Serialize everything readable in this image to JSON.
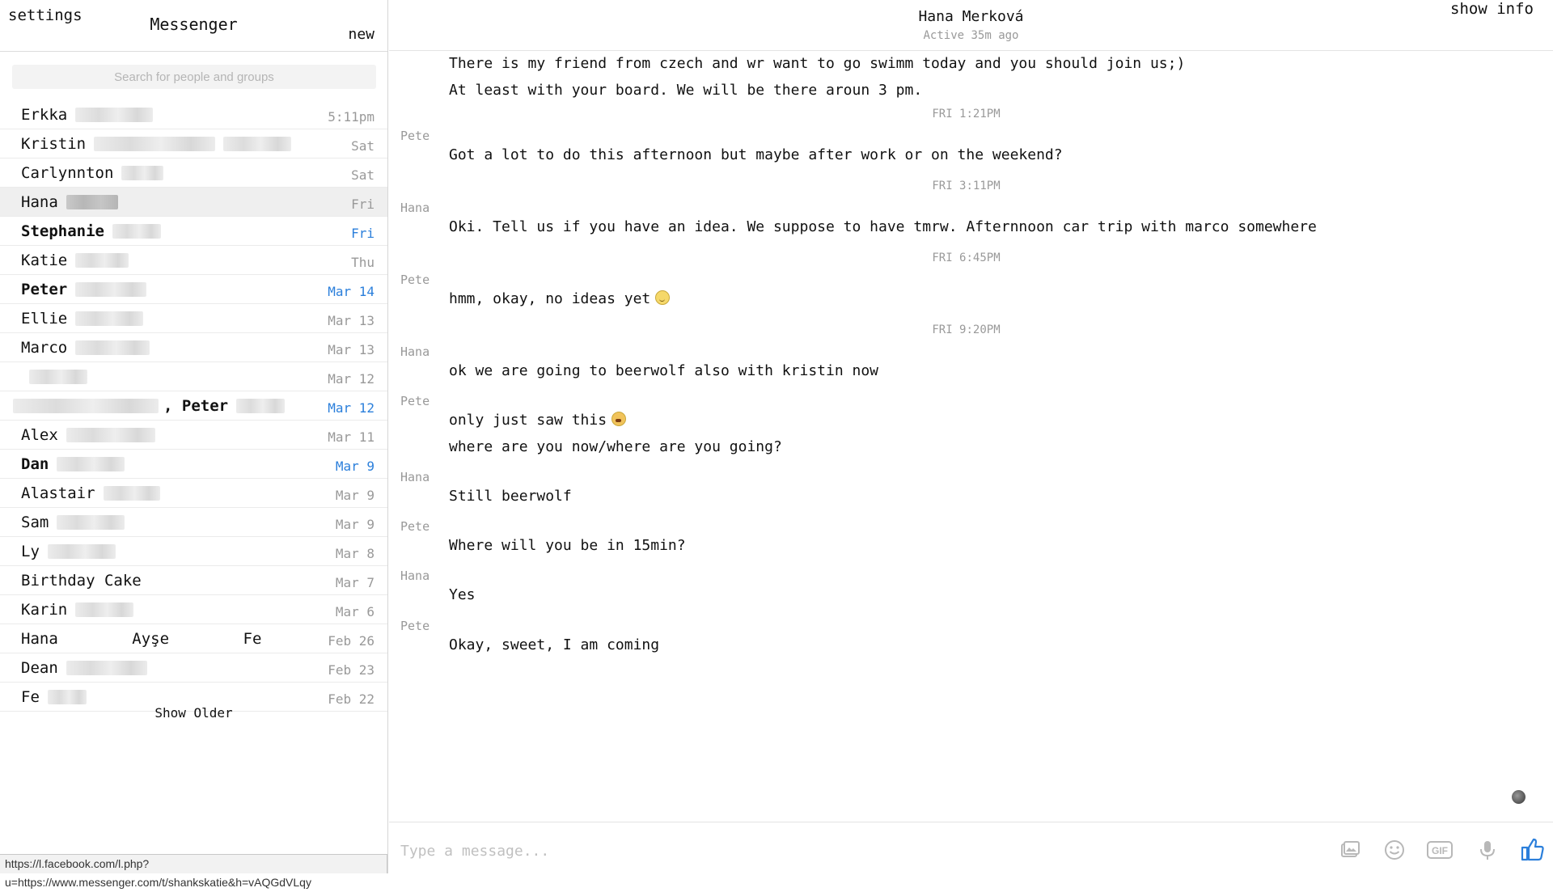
{
  "sidebar": {
    "settings_label": "settings",
    "title": "Messenger",
    "new_label": "new",
    "search_placeholder": "Search for people and groups",
    "show_older_label": "Show Older",
    "conversations": [
      {
        "name": "Erkka",
        "date": "5:11pm",
        "unread": false,
        "selected": false
      },
      {
        "name": "Kristin",
        "date": "Sat",
        "unread": false,
        "selected": false
      },
      {
        "name": "Carlynnton",
        "date": "Sat",
        "unread": false,
        "selected": false
      },
      {
        "name": "Hana",
        "date": "Fri",
        "unread": false,
        "selected": true
      },
      {
        "name": "Stephanie",
        "date": "Fri",
        "unread": true,
        "selected": false
      },
      {
        "name": "Katie",
        "date": "Thu",
        "unread": false,
        "selected": false
      },
      {
        "name": "Peter",
        "date": "Mar 14",
        "unread": true,
        "selected": false
      },
      {
        "name": "Ellie",
        "date": "Mar 13",
        "unread": false,
        "selected": false
      },
      {
        "name": "Marco",
        "date": "Mar 13",
        "unread": false,
        "selected": false
      },
      {
        "name": "",
        "date": "Mar 12",
        "unread": false,
        "selected": false
      },
      {
        "name": ", Peter",
        "date": "Mar 12",
        "unread": true,
        "selected": false
      },
      {
        "name": "Alex",
        "date": "Mar 11",
        "unread": false,
        "selected": false
      },
      {
        "name": "Dan",
        "date": "Mar 9",
        "unread": true,
        "selected": false
      },
      {
        "name": "Alastair",
        "date": "Mar 9",
        "unread": false,
        "selected": false
      },
      {
        "name": "Sam",
        "date": "Mar 9",
        "unread": false,
        "selected": false
      },
      {
        "name": "Ly",
        "date": "Mar 8",
        "unread": false,
        "selected": false
      },
      {
        "name": "Birthday Cake",
        "date": "Mar 7",
        "unread": false,
        "selected": false
      },
      {
        "name": "Karin",
        "date": "Mar 6",
        "unread": false,
        "selected": false
      },
      {
        "name": "Hana        Ayşe        Fe",
        "date": "Feb 26",
        "unread": false,
        "selected": false
      },
      {
        "name": "Dean",
        "date": "Feb 23",
        "unread": false,
        "selected": false
      },
      {
        "name": "Fe",
        "date": "Feb 22",
        "unread": false,
        "selected": false
      }
    ]
  },
  "header": {
    "contact_name": "Hana Merková",
    "contact_status": "Active 35m ago",
    "show_info_label": "show info"
  },
  "thread": [
    {
      "type": "message",
      "text": "There is my friend from czech and wr want to go swimm today and you should join us;)"
    },
    {
      "type": "message",
      "text": "At least with your board. We will be there aroun 3 pm."
    },
    {
      "type": "timestamp",
      "text": "FRI 1:21PM"
    },
    {
      "type": "sender",
      "text": "Pete"
    },
    {
      "type": "message",
      "text": "Got a lot to do this afternoon but maybe after work or on the weekend?"
    },
    {
      "type": "timestamp",
      "text": "FRI 3:11PM"
    },
    {
      "type": "sender",
      "text": "Hana"
    },
    {
      "type": "message",
      "text": "Oki. Tell us if you have an idea. We suppose to have tmrw. Afternnoon car trip with marco somewhere"
    },
    {
      "type": "timestamp",
      "text": "FRI 6:45PM"
    },
    {
      "type": "sender",
      "text": "Pete"
    },
    {
      "type": "message",
      "text": "hmm, okay, no ideas yet",
      "emoji": "slightly-frowning-face-emoji"
    },
    {
      "type": "timestamp",
      "text": "FRI 9:20PM"
    },
    {
      "type": "sender",
      "text": "Hana"
    },
    {
      "type": "message",
      "text": "ok we are going to beerwolf also with kristin now"
    },
    {
      "type": "sender",
      "text": "Pete"
    },
    {
      "type": "message",
      "text": "only just saw this",
      "emoji": "tired-face-emoji"
    },
    {
      "type": "message",
      "text": "where are you now/where are you going?"
    },
    {
      "type": "sender",
      "text": "Hana"
    },
    {
      "type": "message",
      "text": "Still beerwolf"
    },
    {
      "type": "sender",
      "text": "Pete"
    },
    {
      "type": "message",
      "text": "Where will you be in 15min?"
    },
    {
      "type": "sender",
      "text": "Hana"
    },
    {
      "type": "message",
      "text": "Yes"
    },
    {
      "type": "sender",
      "text": "Pete"
    },
    {
      "type": "message",
      "text": "Okay, sweet, I am coming"
    }
  ],
  "composer": {
    "placeholder": "Type a message...",
    "tools": [
      "image-icon",
      "emoji-icon",
      "gif-icon",
      "microphone-icon",
      "thumbs-up-icon"
    ],
    "like_color": "#2b7fdb"
  },
  "status_url": "https://l.facebook.com/l.php?u=https://www.messenger.com/t/shankskatie&h=vAQGdVLqy"
}
